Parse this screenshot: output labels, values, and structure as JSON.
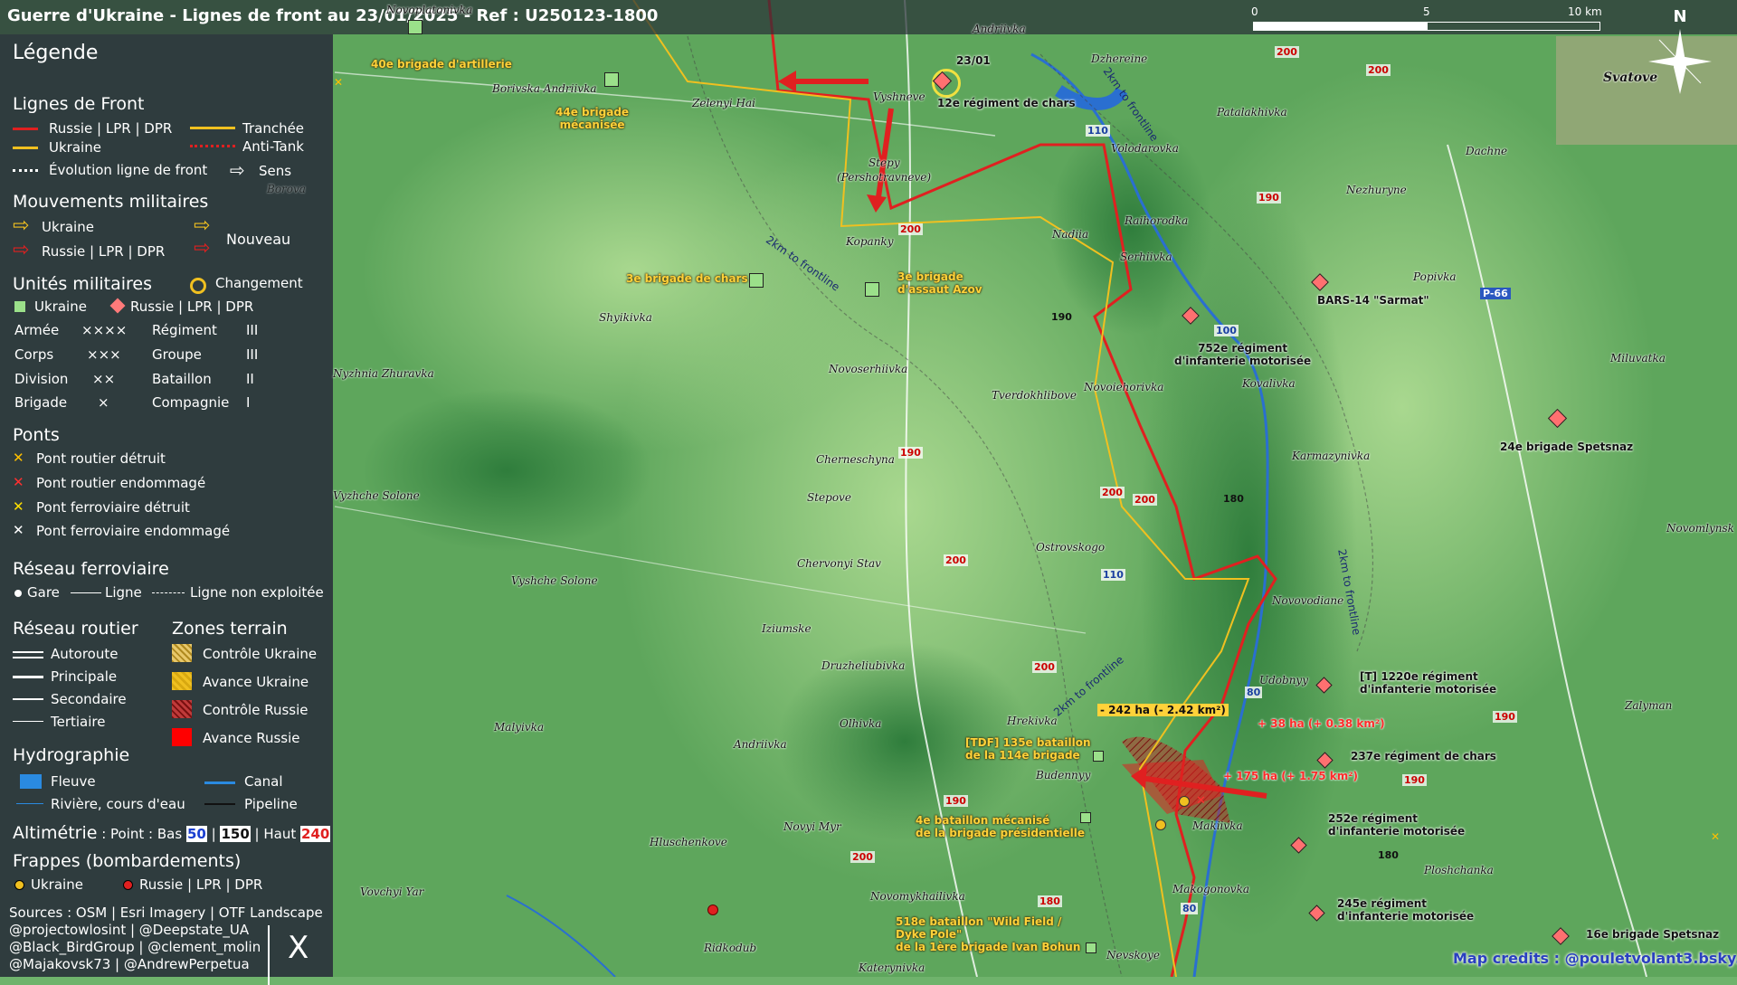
{
  "title": "Guerre d'Ukraine - Lignes de front au 23/01/2025 - Ref : U250123-1800",
  "scale": {
    "labels": [
      "0",
      "5",
      "10 km"
    ]
  },
  "north_label": "N",
  "colors": {
    "russia": "#e02020",
    "ukraine": "#f0c020",
    "terrain": "#4f9f50",
    "legend_bg": "#2c343c"
  },
  "legend": {
    "title": "Légende",
    "front": {
      "heading": "Lignes de Front",
      "russia": "Russie | LPR | DPR",
      "ukraine": "Ukraine",
      "evolution": "Évolution ligne de front",
      "trench": "Tranchée",
      "antitank": "Anti-Tank",
      "direction": "Sens"
    },
    "movements": {
      "heading": "Mouvements militaires",
      "ukraine": "Ukraine",
      "russia": "Russie | LPR | DPR",
      "new": "Nouveau"
    },
    "units": {
      "heading": "Unités militaires",
      "change": "Changement",
      "ukraine": "Ukraine",
      "russia": "Russie | LPR | DPR",
      "echelons": [
        {
          "name": "Armée",
          "sym": "××××"
        },
        {
          "name": "Corps",
          "sym": "×××"
        },
        {
          "name": "Division",
          "sym": "××"
        },
        {
          "name": "Brigade",
          "sym": "×"
        },
        {
          "name": "Régiment",
          "sym": "III"
        },
        {
          "name": "Groupe",
          "sym": "III"
        },
        {
          "name": "Bataillon",
          "sym": "II"
        },
        {
          "name": "Compagnie",
          "sym": "I"
        }
      ]
    },
    "bridges": {
      "heading": "Ponts",
      "items": [
        "Pont routier détruit",
        "Pont routier endommagé",
        "Pont ferroviaire détruit",
        "Pont ferroviaire endommagé"
      ]
    },
    "rail": {
      "heading": "Réseau ferroviaire",
      "station": "Gare",
      "line": "Ligne",
      "unused": "Ligne non exploitée"
    },
    "roads": {
      "heading": "Réseau routier",
      "items": [
        "Autoroute",
        "Principale",
        "Secondaire",
        "Tertiaire"
      ]
    },
    "zones": {
      "heading": "Zones terrain",
      "items": [
        "Contrôle Ukraine",
        "Avance Ukraine",
        "Contrôle Russie",
        "Avance Russie"
      ]
    },
    "hydro": {
      "heading": "Hydrographie",
      "river": "Fleuve",
      "stream": "Rivière, cours d'eau",
      "canal": "Canal",
      "pipeline": "Pipeline"
    },
    "altimetry": {
      "heading": "Altimétrie",
      "text": ": Point : Bas",
      "low": "50",
      "mid": "150",
      "high_text": "| Haut",
      "high": "240"
    },
    "strikes": {
      "heading": "Frappes (bombardements)",
      "ukraine": "Ukraine",
      "russia": "Russie | LPR | DPR"
    },
    "sources": [
      "Sources : OSM | Esri Imagery | OTF Landscape",
      "@projectowlosint | @Deepstate_UA",
      "@Black_BirdGroup | @clement_molin",
      "@Majakovsk73 | @AndrewPerpetua"
    ],
    "x_logo": "X"
  },
  "towns": [
    "Novoplatonivka",
    "Andriivka",
    "Dzhereine",
    "Svatove",
    "Borivska Andriivka",
    "Zelenyi Hai",
    "Vyshneve",
    "Patalakhivka",
    "Volodarovka",
    "Dachne",
    "Stepy",
    "(Pershotravneve)",
    "Nezhuryne",
    "Kopanky",
    "Nadiia",
    "Raihorodka",
    "Serhiivka",
    "Popivka",
    "Shyikivka",
    "Novoserhiivka",
    "Tverdokhlibove",
    "Novoiehorivka",
    "Kovalivka",
    "Miluvatka",
    "Nyzhnia Zhuravka",
    "Karmazynivka",
    "Cherneschyna",
    "Stepove",
    "Vyzhche Solone",
    "Ostrovskogo",
    "Novomlynsk",
    "Chervonyi Stav",
    "Vyshche Solone",
    "Novovodiane",
    "Iziumske",
    "Druzheliubivka",
    "Udobnyy",
    "Zalyman",
    "Hrekivka",
    "Malyivka",
    "Andriivka",
    "Olhivka",
    "Budennyy",
    "Makiivka",
    "Novyi Myr",
    "Hluschenkove",
    "Ploshchanka",
    "Makogonovka",
    "Vovchyi Yar",
    "Novomykhailivka",
    "Ridkodub",
    "Nevskoye",
    "Katerynivka",
    "Borova"
  ],
  "units_ua": [
    {
      "label": "40e brigade d'artillerie"
    },
    {
      "label": "44e brigade\nmécanisée"
    },
    {
      "label": "3e brigade de chars"
    },
    {
      "label": "3e brigade\nd'assaut Azov"
    },
    {
      "label": "[TDF] 135e bataillon\nde la 114e brigade"
    },
    {
      "label": "4e bataillon mécanisé\nde la brigade présidentielle"
    },
    {
      "label": "518e bataillon \"Wild Field /\nDyke Pole\"\nde la 1ère brigade Ivan Bohun"
    }
  ],
  "units_ru": [
    {
      "label": "12e régiment de chars",
      "date": "23/01"
    },
    {
      "label": "BARS-14 \"Sarmat\""
    },
    {
      "label": "752e régiment\nd'infanterie motorisée"
    },
    {
      "label": "24e brigade Spetsnaz"
    },
    {
      "label": "[T] 1220e régiment\nd'infanterie motorisée"
    },
    {
      "label": "237e régiment de chars"
    },
    {
      "label": "252e régiment\nd'infanterie motorisée"
    },
    {
      "label": "245e régiment\nd'infanterie motorisée"
    },
    {
      "label": "16e brigade Spetsnaz"
    }
  ],
  "gains": {
    "ua_loss": "- 242 ha (- 2.42 km²)",
    "ru_gain1": "+ 38 ha (+ 0.38 km²)",
    "ru_gain2": "+ 175 ha (+ 1.75 km²)"
  },
  "frontline_notes": [
    "2km to frontline",
    "2km to frontline",
    "2km to frontline",
    "2km to frontline"
  ],
  "altitudes": [
    "200",
    "200",
    "190",
    "200",
    "190",
    "190",
    "200",
    "200",
    "200",
    "180",
    "190",
    "180",
    "200",
    "190",
    "180",
    "200",
    "190"
  ],
  "road_numbers": [
    "110",
    "110",
    "100",
    "110",
    "80",
    "80"
  ],
  "road_labels": [
    "P-66"
  ],
  "credit": "Map credits : @pouletvolant3.bsky.social"
}
